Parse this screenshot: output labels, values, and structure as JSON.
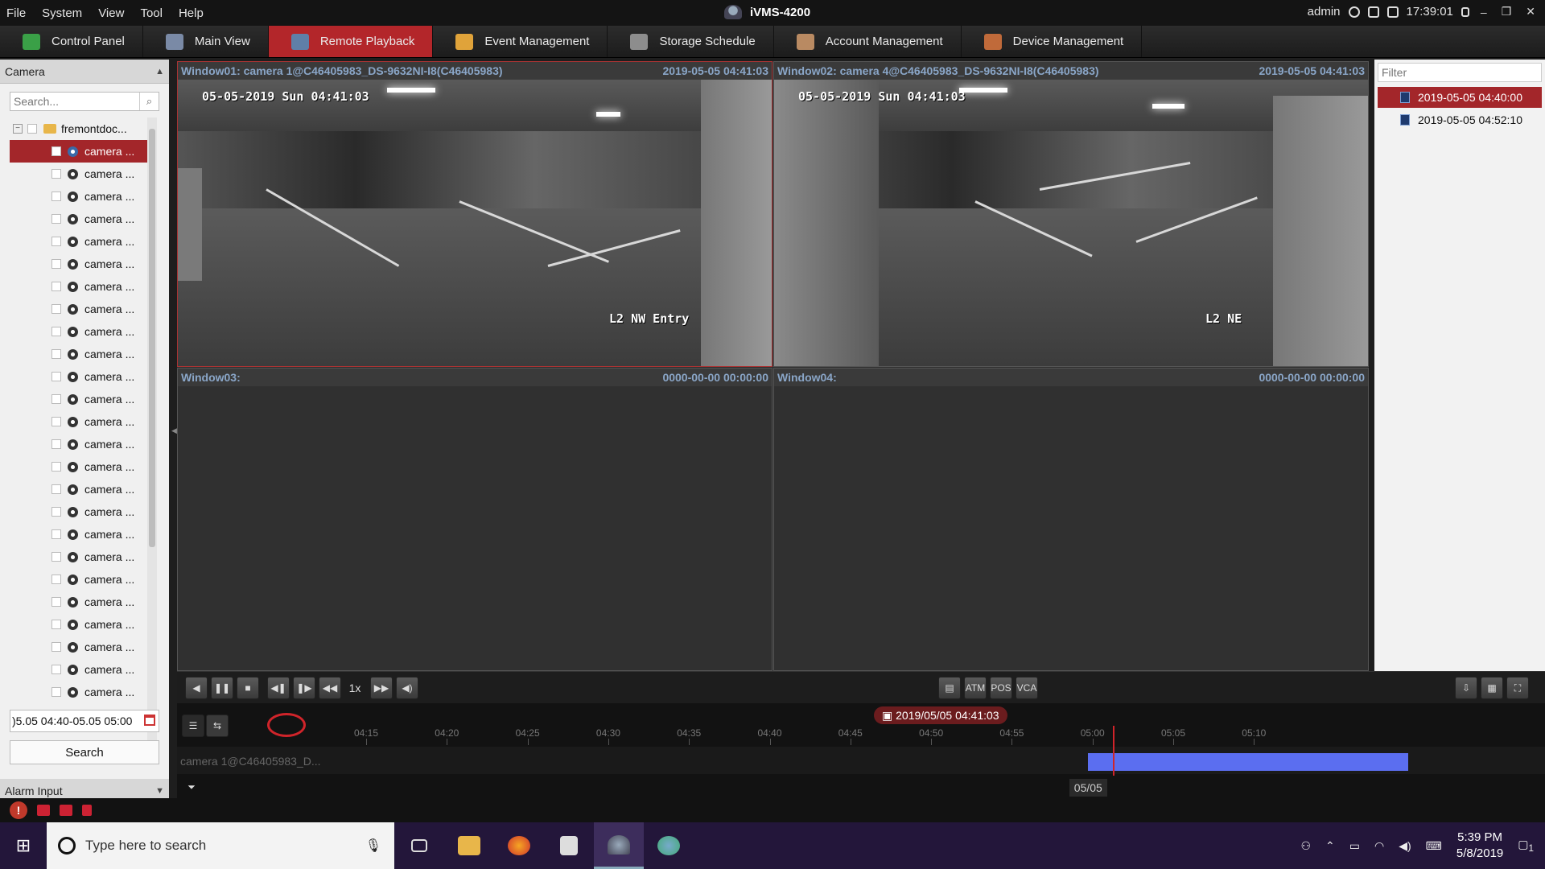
{
  "menu": {
    "items": [
      "File",
      "System",
      "View",
      "Tool",
      "Help"
    ]
  },
  "app_title": "iVMS-4200",
  "topright": {
    "user": "admin",
    "time": "17:39:01"
  },
  "tabs": [
    {
      "label": "Control Panel",
      "color": "#3aa047"
    },
    {
      "label": "Main View",
      "color": "#7a8aa6"
    },
    {
      "label": "Remote Playback",
      "color": "#5f7fa8",
      "active": true
    },
    {
      "label": "Event Management",
      "color": "#e0a33a"
    },
    {
      "label": "Storage Schedule",
      "color": "#8d8d8d"
    },
    {
      "label": "Account Management",
      "color": "#b98a62"
    },
    {
      "label": "Device Management",
      "color": "#c06a3a"
    }
  ],
  "left_panel": {
    "title": "Camera",
    "search_placeholder": "Search...",
    "root_label": "fremontdoc...",
    "cameras": [
      "camera ...",
      "camera ...",
      "camera ...",
      "camera ...",
      "camera ...",
      "camera ...",
      "camera ...",
      "camera ...",
      "camera ...",
      "camera ...",
      "camera ...",
      "camera ...",
      "camera ...",
      "camera ...",
      "camera ...",
      "camera ...",
      "camera ...",
      "camera ...",
      "camera ...",
      "camera ...",
      "camera ...",
      "camera ...",
      "camera ...",
      "camera ...",
      "camera ..."
    ],
    "date_range": ")5.05 04:40-05.05 05:00",
    "search_button": "Search",
    "alarm_input": "Alarm Input"
  },
  "windows": [
    {
      "name": "Window01:  camera 1@C46405983_DS-9632NI-I8(C46405983)",
      "time": "2019-05-05 04:41:03",
      "osd_time": "05-05-2019 Sun 04:41:03",
      "osd_label": "L2 NW Entry"
    },
    {
      "name": "Window02:  camera 4@C46405983_DS-9632NI-I8(C46405983)",
      "time": "2019-05-05 04:41:03",
      "osd_time": "05-05-2019 Sun 04:41:03",
      "osd_label": "L2 NE"
    },
    {
      "name": "Window03:",
      "time": "0000-00-00 00:00:00"
    },
    {
      "name": "Window04:",
      "time": "0000-00-00 00:00:00"
    }
  ],
  "right_panel": {
    "filter_placeholder": "Filter",
    "records": [
      "2019-05-05 04:40:00",
      "2019-05-05 04:52:10"
    ]
  },
  "playback": {
    "speed": "1x"
  },
  "timeline": {
    "current": "2019/05/05 04:41:03",
    "ticks": [
      "04:15",
      "04:20",
      "04:25",
      "04:30",
      "04:35",
      "04:40",
      "04:45",
      "04:50",
      "04:55",
      "05:00",
      "05:05",
      "05:10"
    ],
    "track_label": "camera 1@C46405983_D...",
    "date_tag": "05/05",
    "recording_start_fraction": 0.666,
    "recording_end_fraction": 0.9,
    "cursor_fraction": 0.684,
    "bar_color": "#5b6ef0"
  },
  "taskbar": {
    "search_placeholder": "Type here to search",
    "clock_time": "5:39 PM",
    "clock_date": "5/8/2019",
    "notif_count": "1"
  }
}
